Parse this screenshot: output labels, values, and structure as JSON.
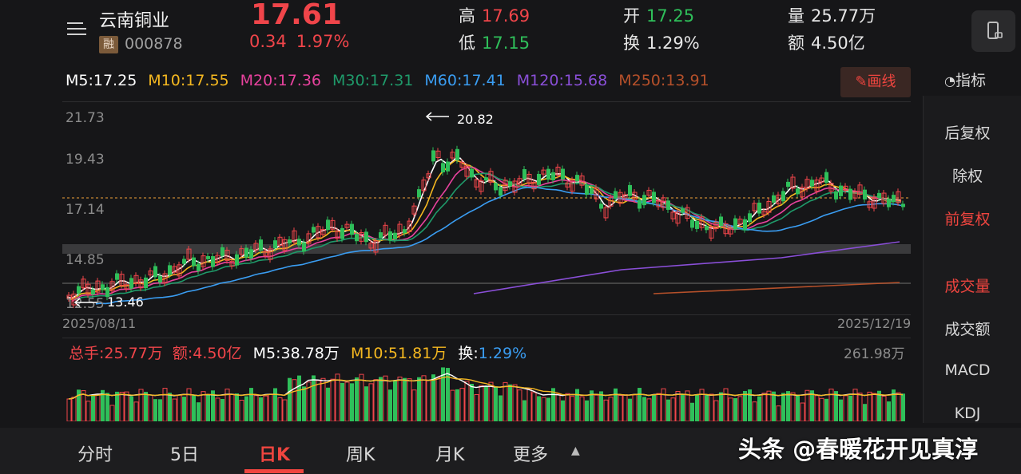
{
  "header": {
    "stock_name": "云南铜业",
    "badge": "融",
    "code": "000878",
    "price": "17.61",
    "change": "0.34",
    "change_pct": "1.97%",
    "high_label": "高",
    "high": "17.69",
    "low_label": "低",
    "low": "17.15",
    "open_label": "开",
    "open": "17.25",
    "turnover_label": "换",
    "turnover": "1.29%",
    "volume_label": "量",
    "volume": "25.77万",
    "amount_label": "额",
    "amount": "4.50亿"
  },
  "ma": {
    "m5": "M5:17.25",
    "m10": "M10:17.55",
    "m20": "M20:17.36",
    "m30": "M30:17.31",
    "m60": "M60:17.41",
    "m120": "M120:15.68",
    "m250": "M250:13.91"
  },
  "colors": {
    "m5": "#ffffff",
    "m10": "#f5b820",
    "m20": "#e8429e",
    "m30": "#1f9a6a",
    "m60": "#3a9df2",
    "m120": "#8a4fd8",
    "m250": "#b5502a",
    "up": "#f0454a",
    "down": "#2fbf5a"
  },
  "toolbar": {
    "draw_label": "画线",
    "indicator_label": "指标"
  },
  "chart": {
    "y_ticks": [
      "21.73",
      "19.43",
      "17.14",
      "14.85",
      "12.55"
    ],
    "max_label": "20.82",
    "min_label": "13.46",
    "start_date": "2025/08/11",
    "end_date": "2025/12/19"
  },
  "volume": {
    "total": "总手:25.77万",
    "amount": "额:4.50亿",
    "m5": "M5:38.78万",
    "m10": "M10:51.81万",
    "turnover_label": "换:",
    "turnover": "1.29%",
    "max": "261.98万"
  },
  "sidebar": {
    "items": [
      "后复权",
      "除权",
      "前复权",
      "成交量",
      "成交额",
      "MACD",
      "KDJ"
    ]
  },
  "tabs": [
    "分时",
    "5日",
    "日K",
    "周K",
    "月K",
    "更多"
  ],
  "watermark": "头条 @春暖花开见真淳",
  "chart_data": {
    "type": "candlestick",
    "y_ticks": [
      21.73,
      19.43,
      17.14,
      14.85,
      12.55
    ],
    "max_price": 20.82,
    "min_price": 13.46,
    "x_range": [
      "2025/08/11",
      "2025/12/19"
    ],
    "last_close": 17.61,
    "volume_max": "261.98万"
  }
}
